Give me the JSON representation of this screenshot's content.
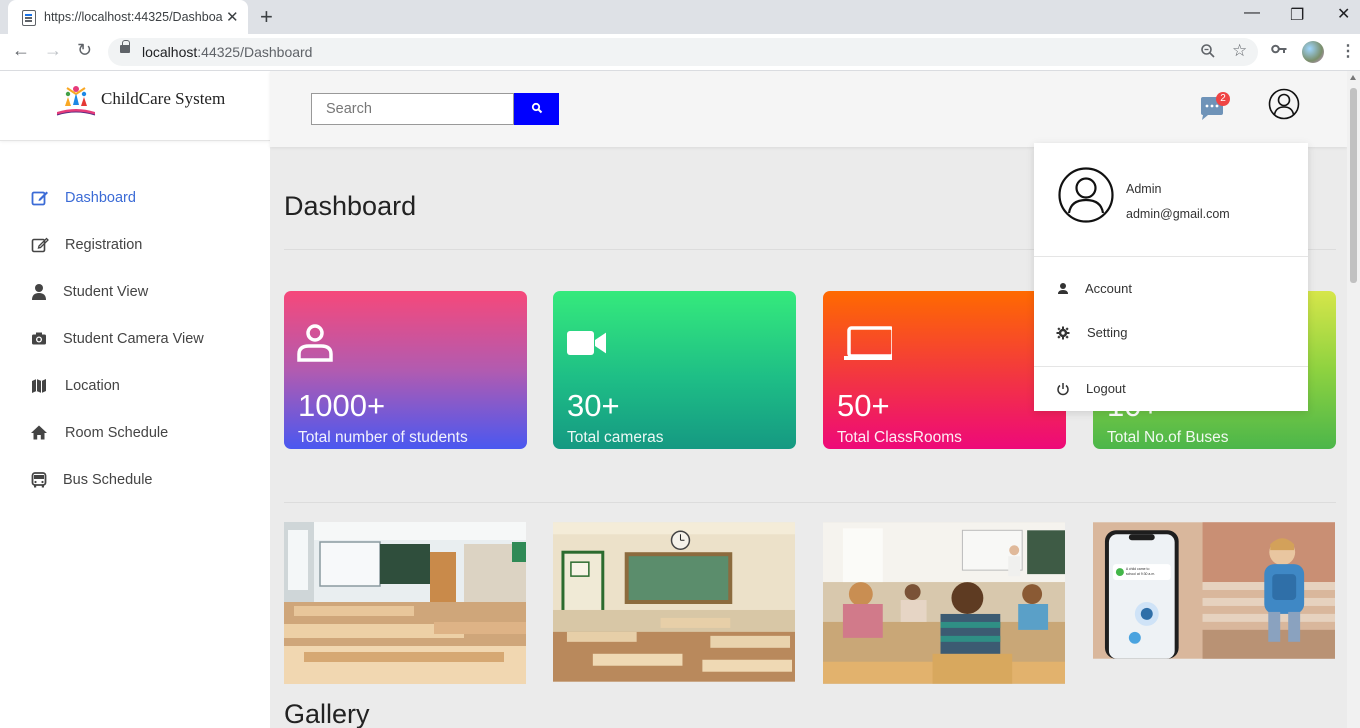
{
  "browser": {
    "tab_title": "https://localhost:44325/Dashboa",
    "url_host": "localhost",
    "url_rest": ":44325/Dashboard"
  },
  "brand": {
    "name": "ChildCare System"
  },
  "sidebar": {
    "items": [
      {
        "label": "Dashboard",
        "icon": "edit-icon",
        "active": true
      },
      {
        "label": "Registration",
        "icon": "edit-icon"
      },
      {
        "label": "Student View",
        "icon": "user-icon"
      },
      {
        "label": "Student Camera View",
        "icon": "camera-icon"
      },
      {
        "label": "Location",
        "icon": "map-icon"
      },
      {
        "label": "Room Schedule",
        "icon": "home-icon"
      },
      {
        "label": "Bus Schedule",
        "icon": "bus-icon"
      }
    ]
  },
  "topbar": {
    "search_placeholder": "Search",
    "chat_badge": "2"
  },
  "main": {
    "title": "Dashboard",
    "gallery_title": "Gallery"
  },
  "cards": [
    {
      "value": "1000+",
      "label": "Total number of students",
      "icon": "user-icon"
    },
    {
      "value": "30+",
      "label": "Total cameras",
      "icon": "video-camera-icon"
    },
    {
      "value": "50+",
      "label": "Total ClassRooms",
      "icon": "laptop-icon"
    },
    {
      "value": "10+",
      "label": "Total No.of Buses",
      "icon": "bus-icon"
    }
  ],
  "photos": [
    {
      "alt": "classroom-photo"
    },
    {
      "alt": "classroom-photo"
    },
    {
      "alt": "classroom-photo"
    },
    {
      "alt": "phone-tracking-photo",
      "notification": "A child came to school at 9:30 a.m."
    }
  ],
  "user_menu": {
    "name": "Admin",
    "email": "admin@gmail.com",
    "items": [
      {
        "label": "Account",
        "icon": "user-icon"
      },
      {
        "label": "Setting",
        "icon": "gear-icon"
      },
      {
        "label": "Logout",
        "icon": "power-icon"
      }
    ]
  },
  "colors": {
    "accent": "#3b6bd6",
    "search_button": "#0000ff",
    "badge": "#ef4444"
  }
}
